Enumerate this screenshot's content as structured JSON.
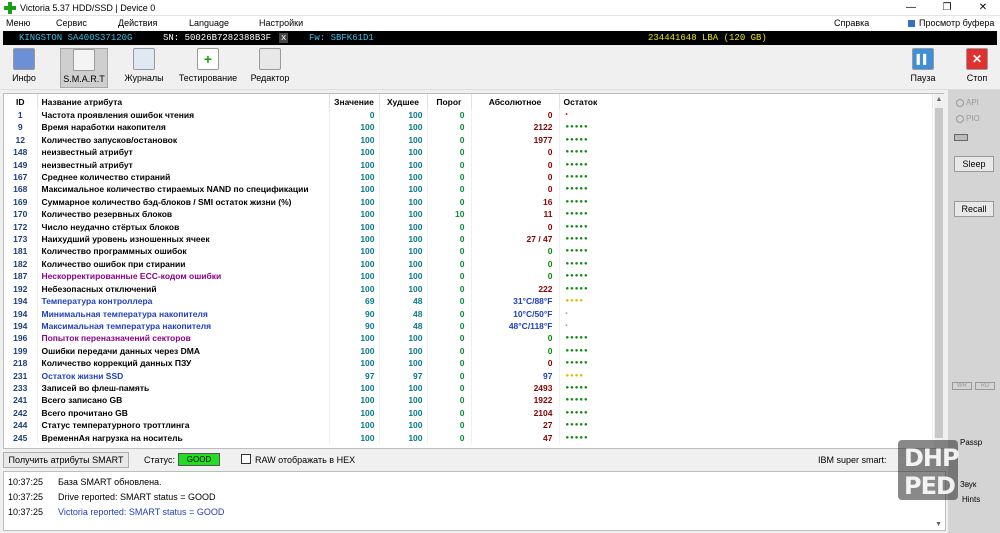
{
  "window": {
    "title": "Victoria 5.37 HDD/SSD | Device 0",
    "minimize": "—",
    "maximize": "❐",
    "close": "✕"
  },
  "menu": {
    "items": [
      "Меню",
      "Сервис",
      "Действия",
      "Language",
      "Настройки"
    ],
    "right_items": [
      "Справка",
      "Просмотр буфера"
    ]
  },
  "drive": {
    "model": "KINGSTON SA400S37120G",
    "serial": "SN: 50026B7282388B3F",
    "x": "x",
    "fw": "Fw: SBFK61D1",
    "lba": "234441648 LBA (120 GB)"
  },
  "toolbar": {
    "buttons": [
      "Инфо",
      "S.M.A.R.T",
      "Журналы",
      "Тестирование",
      "Редактор"
    ],
    "right_buttons": [
      "Пауза",
      "Стоп"
    ]
  },
  "table": {
    "headers": [
      "ID",
      "Название атрибута",
      "Значение",
      "Худшее",
      "Порог",
      "Абсолютное",
      "Остаток"
    ],
    "rows": [
      {
        "id": "1",
        "name": "Частота проявления ошибок чтения",
        "value": "0",
        "worst": "100",
        "threshold": "0",
        "raw": "0",
        "health": "•",
        "name_color": "#000000",
        "raw_color": "#8b0000",
        "health_color": "#dd0000"
      },
      {
        "id": "9",
        "name": "Время наработки накопителя",
        "value": "100",
        "worst": "100",
        "threshold": "0",
        "raw": "2122",
        "health": "●●●●●",
        "name_color": "#000000",
        "raw_color": "#8b0000",
        "health_color": "#0a8a0a"
      },
      {
        "id": "12",
        "name": "Количество запусков/остановок",
        "value": "100",
        "worst": "100",
        "threshold": "0",
        "raw": "1977",
        "health": "●●●●●",
        "name_color": "#000000",
        "raw_color": "#8b0000",
        "health_color": "#0a8a0a"
      },
      {
        "id": "148",
        "name": "неизвестный атрибут",
        "value": "100",
        "worst": "100",
        "threshold": "0",
        "raw": "0",
        "health": "●●●●●",
        "name_color": "#000000",
        "raw_color": "#8b0000",
        "health_color": "#0a8a0a"
      },
      {
        "id": "149",
        "name": "неизвестный атрибут",
        "value": "100",
        "worst": "100",
        "threshold": "0",
        "raw": "0",
        "health": "●●●●●",
        "name_color": "#000000",
        "raw_color": "#8b0000",
        "health_color": "#0a8a0a"
      },
      {
        "id": "167",
        "name": "Среднее количество стираний",
        "value": "100",
        "worst": "100",
        "threshold": "0",
        "raw": "0",
        "health": "●●●●●",
        "name_color": "#000000",
        "raw_color": "#8b0000",
        "health_color": "#0a8a0a"
      },
      {
        "id": "168",
        "name": "Максимальное количество стираемых NAND по спецификации",
        "value": "100",
        "worst": "100",
        "threshold": "0",
        "raw": "0",
        "health": "●●●●●",
        "name_color": "#000000",
        "raw_color": "#8b0000",
        "health_color": "#0a8a0a"
      },
      {
        "id": "169",
        "name": "Суммарное количество бэд-блоков / SMI остаток жизни (%)",
        "value": "100",
        "worst": "100",
        "threshold": "0",
        "raw": "16",
        "health": "●●●●●",
        "name_color": "#000000",
        "raw_color": "#8b0000",
        "health_color": "#0a8a0a"
      },
      {
        "id": "170",
        "name": "Количество резервных блоков",
        "value": "100",
        "worst": "100",
        "threshold": "10",
        "raw": "11",
        "health": "●●●●●",
        "name_color": "#000000",
        "raw_color": "#8b0000",
        "health_color": "#0a8a0a"
      },
      {
        "id": "172",
        "name": "Число неудачно стёртых блоков",
        "value": "100",
        "worst": "100",
        "threshold": "0",
        "raw": "0",
        "health": "●●●●●",
        "name_color": "#000000",
        "raw_color": "#8b0000",
        "health_color": "#0a8a0a"
      },
      {
        "id": "173",
        "name": "Наихудший уровень изношенных ячеек",
        "value": "100",
        "worst": "100",
        "threshold": "0",
        "raw": "27 / 47",
        "health": "●●●●●",
        "name_color": "#000000",
        "raw_color": "#8b0000",
        "health_color": "#0a8a0a"
      },
      {
        "id": "181",
        "name": "Количество программных ошибок",
        "value": "100",
        "worst": "100",
        "threshold": "0",
        "raw": "0",
        "health": "●●●●●",
        "name_color": "#000000",
        "raw_color": "#0a8a0a",
        "health_color": "#0a8a0a"
      },
      {
        "id": "182",
        "name": "Количество ошибок при стирании",
        "value": "100",
        "worst": "100",
        "threshold": "0",
        "raw": "0",
        "health": "●●●●●",
        "name_color": "#000000",
        "raw_color": "#0a8a0a",
        "health_color": "#0a8a0a"
      },
      {
        "id": "187",
        "name": "Нескорректированные ECC-кодом ошибки",
        "value": "100",
        "worst": "100",
        "threshold": "0",
        "raw": "0",
        "health": "●●●●●",
        "name_color": "#8b008b",
        "raw_color": "#0a8a0a",
        "health_color": "#0a8a0a"
      },
      {
        "id": "192",
        "name": "Небезопасных отключений",
        "value": "100",
        "worst": "100",
        "threshold": "0",
        "raw": "222",
        "health": "●●●●●",
        "name_color": "#000000",
        "raw_color": "#8b0000",
        "health_color": "#0a8a0a"
      },
      {
        "id": "194",
        "name": "Температура контроллера",
        "value": "69",
        "worst": "48",
        "threshold": "0",
        "raw": "31°C/88°F",
        "health": "●●●●",
        "name_color": "#1f3fbf",
        "raw_color": "#1f3fbf",
        "health_color": "#e6b800"
      },
      {
        "id": "194",
        "name": "Минимальная температура накопителя",
        "value": "90",
        "worst": "48",
        "threshold": "0",
        "raw": "10°C/50°F",
        "health": "-",
        "name_color": "#1f3fbf",
        "raw_color": "#1f3fbf",
        "health_color": "#333333"
      },
      {
        "id": "194",
        "name": "Максимальная температура накопителя",
        "value": "90",
        "worst": "48",
        "threshold": "0",
        "raw": "48°C/118°F",
        "health": "-",
        "name_color": "#1f3fbf",
        "raw_color": "#1f3fbf",
        "health_color": "#333333"
      },
      {
        "id": "196",
        "name": "Попыток переназначений секторов",
        "value": "100",
        "worst": "100",
        "threshold": "0",
        "raw": "0",
        "health": "●●●●●",
        "name_color": "#8b008b",
        "raw_color": "#0a8a0a",
        "health_color": "#0a8a0a"
      },
      {
        "id": "199",
        "name": "Ошибки передачи данных через DMA",
        "value": "100",
        "worst": "100",
        "threshold": "0",
        "raw": "0",
        "health": "●●●●●",
        "name_color": "#000000",
        "raw_color": "#0a8a0a",
        "health_color": "#0a8a0a"
      },
      {
        "id": "218",
        "name": "Количество коррекций данных ПЗУ",
        "value": "100",
        "worst": "100",
        "threshold": "0",
        "raw": "0",
        "health": "●●●●●",
        "name_color": "#000000",
        "raw_color": "#8b0000",
        "health_color": "#0a8a0a"
      },
      {
        "id": "231",
        "name": "Остаток жизни SSD",
        "value": "97",
        "worst": "97",
        "threshold": "0",
        "raw": "97",
        "health": "●●●●",
        "name_color": "#1f3fbf",
        "raw_color": "#1f3fbf",
        "health_color": "#e6b800"
      },
      {
        "id": "233",
        "name": "Записей во флеш-память",
        "value": "100",
        "worst": "100",
        "threshold": "0",
        "raw": "2493",
        "health": "●●●●●",
        "name_color": "#000000",
        "raw_color": "#8b0000",
        "health_color": "#0a8a0a"
      },
      {
        "id": "241",
        "name": "Всего записано GB",
        "value": "100",
        "worst": "100",
        "threshold": "0",
        "raw": "1922",
        "health": "●●●●●",
        "name_color": "#000000",
        "raw_color": "#8b0000",
        "health_color": "#0a8a0a"
      },
      {
        "id": "242",
        "name": "Всего прочитано GB",
        "value": "100",
        "worst": "100",
        "threshold": "0",
        "raw": "2104",
        "health": "●●●●●",
        "name_color": "#000000",
        "raw_color": "#8b0000",
        "health_color": "#0a8a0a"
      },
      {
        "id": "244",
        "name": "Статус температурного троттлинга",
        "value": "100",
        "worst": "100",
        "threshold": "0",
        "raw": "27",
        "health": "●●●●●",
        "name_color": "#000000",
        "raw_color": "#8b0000",
        "health_color": "#0a8a0a"
      },
      {
        "id": "245",
        "name": "ВременнАя нагрузка на носитель",
        "value": "100",
        "worst": "100",
        "threshold": "0",
        "raw": "47",
        "health": "●●●●●",
        "name_color": "#000000",
        "raw_color": "#8b0000",
        "health_color": "#0a8a0a"
      }
    ]
  },
  "right_panel": {
    "api": "API",
    "pio": "PIO",
    "sleep": "Sleep",
    "recall": "Recall",
    "wr": "WR",
    "rd": "RD",
    "passp": "Passp",
    "sound": "Звук",
    "hints": "Hints"
  },
  "status": {
    "get_button": "Получить атрибуты SMART",
    "status_label": "Статус:",
    "status_value": "GOOD",
    "raw_hex": "RAW отображать в HEX",
    "ibm": "IBM super smart:"
  },
  "log": [
    {
      "time": "10:37:25",
      "text": "База SMART обновлена.",
      "color": "#000000"
    },
    {
      "time": "10:37:25",
      "text": "Drive reported: SMART status = GOOD",
      "color": "#000000"
    },
    {
      "time": "10:37:25",
      "text": "Victoria reported: SMART status = GOOD",
      "color": "#1f3fbf"
    }
  ],
  "watermark": {
    "line1": "DHP",
    "line2": "PED"
  },
  "colors": {
    "value": "#0a7a8a",
    "threshold": "#0a8a3a",
    "status_good": "#22dd22"
  }
}
